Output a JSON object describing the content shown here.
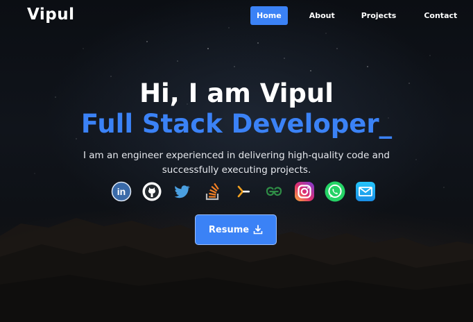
{
  "brand": {
    "name": "Vipul"
  },
  "nav": {
    "items": [
      {
        "label": "Home",
        "active": true
      },
      {
        "label": "About",
        "active": false
      },
      {
        "label": "Projects",
        "active": false
      },
      {
        "label": "Contact",
        "active": false
      }
    ]
  },
  "hero": {
    "greeting": "Hi, I am Vipul",
    "role": "Full Stack Developer_",
    "description": "I am an engineer experienced in delivering high-quality code and successfully executing projects."
  },
  "socials": [
    {
      "icon": "linkedin-icon"
    },
    {
      "icon": "github-icon"
    },
    {
      "icon": "twitter-icon"
    },
    {
      "icon": "stackoverflow-icon"
    },
    {
      "icon": "hackerrank-icon"
    },
    {
      "icon": "geeksforgeeks-icon"
    },
    {
      "icon": "instagram-icon"
    },
    {
      "icon": "whatsapp-icon"
    },
    {
      "icon": "email-icon"
    }
  ],
  "resume": {
    "label": "Resume",
    "icon": "download-icon"
  },
  "colors": {
    "accent": "#3b82f6",
    "background": "#0a0d12",
    "text": "#ffffff"
  }
}
